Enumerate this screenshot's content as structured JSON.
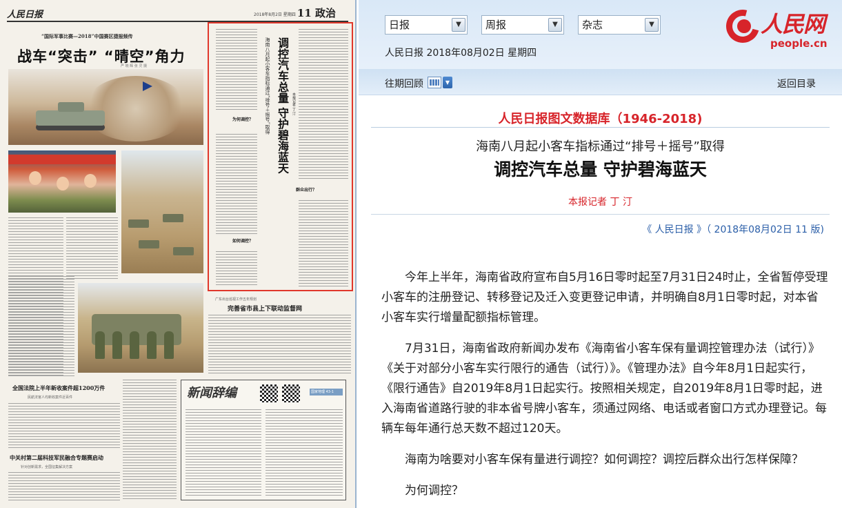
{
  "paper": {
    "logo": "人民日报",
    "date": "2018年8月2日 星期四",
    "page_label": "11 政治",
    "kicker": "“国际军事比赛—2018”中国赛区捷报频传",
    "headline": "战车“突击” “晴空”角力",
    "photo_credit": "严 晓 辉   张 灵 摄",
    "article_title": "调控汽车总量 守护碧海蓝天",
    "article_subtitle": "海南八月起小客车指标通过“排号＋摇号”取得",
    "article_byline": "本报记者 丁 汀",
    "section_why": "为何调控？",
    "section_how": "如何调控？",
    "section_travel": "群众出行？",
    "headline_guangdong_kicker": "广东出台巡视工作五年规划",
    "headline_guangdong": "完善省市县上下联动监督网",
    "headline_court": "全国法院上半年新收案件超1200万件",
    "headline_court_sub": "民航法官人均新收案件近百件",
    "headline_zgc": "中关村第二届科技军民融合专题赛启动",
    "headline_zgc_sub": "针对创新需求，全国征集解决方案",
    "ad_title": "新闻辞编",
    "ad_tag": "国家地理 43-1"
  },
  "site": {
    "selects": [
      {
        "value": "日报"
      },
      {
        "value": "周报"
      },
      {
        "value": "杂志"
      }
    ],
    "edition_date": "人民日报 2018年08月02日 星期四",
    "logo_cn": "人民网",
    "logo_en": "people.cn",
    "past_label": "往期回顾",
    "back_link": "返回目录",
    "db_title": "人民日报图文数据库（1946-2018)",
    "article": {
      "subtitle": "海南八月起小客车指标通过“排号＋摇号”取得",
      "title": "调控汽车总量 守护碧海蓝天",
      "byline": "本报记者 丁 汀",
      "source": "《 人民日报 》（ 2018年08月02日   11 版)",
      "paragraphs": [
        "今年上半年，海南省政府宣布自5月16日零时起至7月31日24时止，全省暂停受理小客车的注册登记、转移登记及迁入变更登记申请，并明确自8月1日零时起，对本省小客车实行增量配额指标管理。",
        "7月31日，海南省政府新闻办发布《海南省小客车保有量调控管理办法（试行）》《关于对部分小客车实行限行的通告（试行）》。《管理办法》自今年8月1日起实行，《限行通告》自2019年8月1日起实行。按照相关规定，自2019年8月1日零时起，进入海南省道路行驶的非本省号牌小客车，须通过网络、电话或者窗口方式办理登记。每辆车每年通行总天数不超过120天。",
        "海南为啥要对小客车保有量进行调控？如何调控？调控后群众出行怎样保障？",
        "为何调控？"
      ]
    }
  }
}
